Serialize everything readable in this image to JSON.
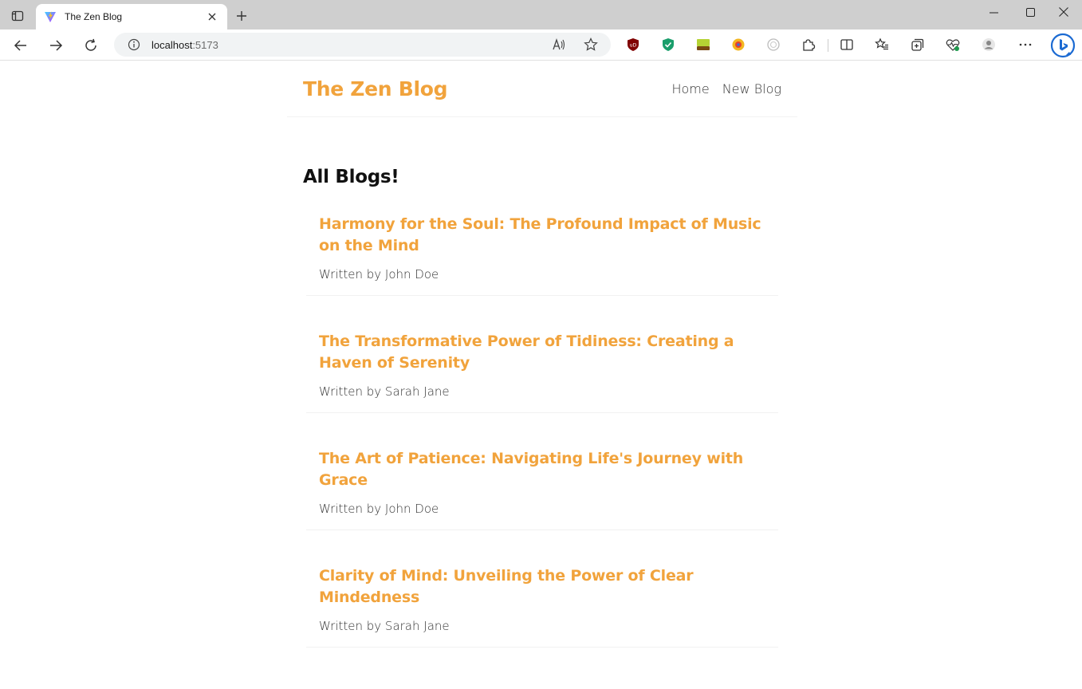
{
  "browser": {
    "tab_title": "The Zen Blog",
    "url_host": "localhost",
    "url_port": ":5173",
    "icons": {
      "tab_actions": "tab-actions-icon",
      "favicon": "vite-logo-icon",
      "close": "close-icon",
      "new_tab": "plus-icon",
      "back": "arrow-left-icon",
      "forward": "arrow-right-icon",
      "reload": "reload-icon",
      "info": "info-icon",
      "read_aloud": "read-aloud-icon",
      "favorite": "star-icon"
    }
  },
  "site": {
    "brand": "The Zen Blog",
    "nav": [
      {
        "label": "Home"
      },
      {
        "label": "New Blog"
      }
    ],
    "brand_color": "#f1a33c"
  },
  "main": {
    "section_title": "All Blogs!",
    "blogs": [
      {
        "title": "Harmony for the Soul: The Profound Impact of Music on the Mind",
        "author": "Written by John Doe"
      },
      {
        "title": "The Transformative Power of Tidiness: Creating a Haven of Serenity",
        "author": "Written by Sarah Jane"
      },
      {
        "title": "The Art of Patience: Navigating Life's Journey with Grace",
        "author": "Written by John Doe"
      },
      {
        "title": "Clarity of Mind: Unveiling the Power of Clear Mindedness",
        "author": "Written by Sarah Jane"
      }
    ]
  }
}
